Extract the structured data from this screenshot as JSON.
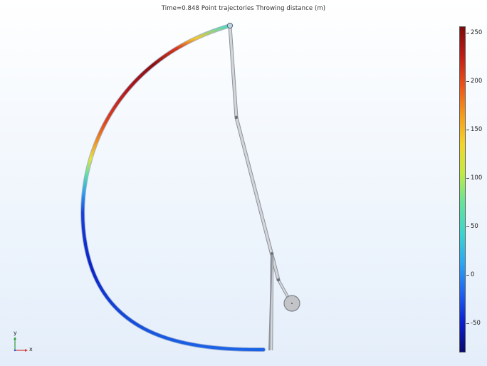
{
  "plot": {
    "title": "Time=0.848 Point trajectories   Throwing distance (m)"
  },
  "colorbar": {
    "ticks": [
      "250",
      "200",
      "150",
      "100",
      "50",
      "0",
      "-50"
    ],
    "gradient_colors": [
      "#0a0a6e",
      "#0b1fd0",
      "#2ba5f2",
      "#66e39a",
      "#f3d529",
      "#ec5218",
      "#7c0a0a"
    ]
  },
  "axes": {
    "x_label": "x",
    "y_label": "y"
  },
  "colors": {
    "arm": "#c9cdd3",
    "arm_outline": "#8e939a",
    "weight": "#c2c4c8",
    "background_top": "#ffffff",
    "background_bottom": "#e4eefa"
  }
}
